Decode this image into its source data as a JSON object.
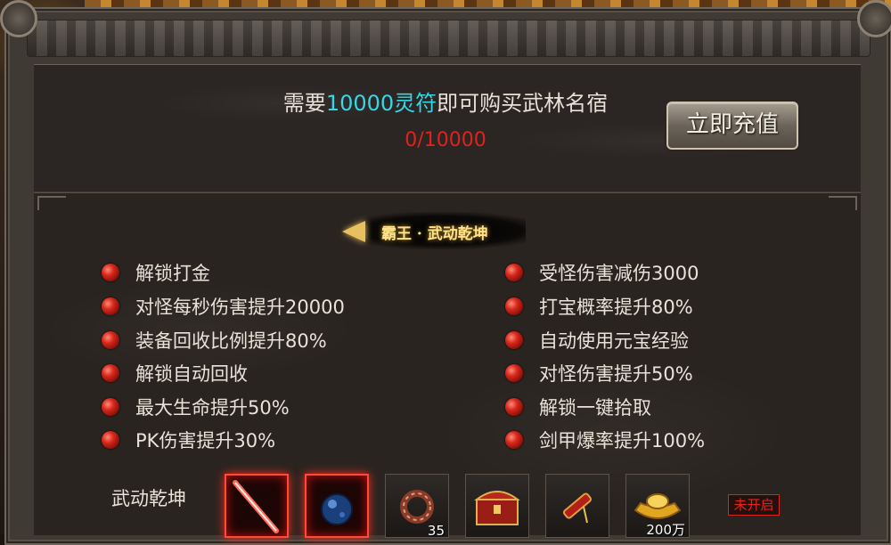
{
  "header": {
    "message_prefix": "需要",
    "message_highlight": "10000灵符",
    "message_suffix": "即可购买武林名宿",
    "progress": "0/10000",
    "recharge_button": "立即充值"
  },
  "tier": {
    "title": "霸王 · 武动乾坤"
  },
  "perks_left": [
    "解锁打金",
    "对怪每秒伤害提升20000",
    "装备回收比例提升80%",
    "解锁自动回收",
    "最大生命提升50%",
    "PK伤害提升30%"
  ],
  "perks_right": [
    "受怪伤害减伤3000",
    "打宝概率提升80%",
    "自动使用元宝经验",
    "对怪伤害提升50%",
    "解锁一键拾取",
    "剑甲爆率提升100%"
  ],
  "rewards": {
    "row_label": "武动乾坤",
    "items": [
      {
        "icon": "red-sword-icon",
        "count": ""
      },
      {
        "icon": "blue-orb-icon",
        "count": ""
      },
      {
        "icon": "bead-bracelet-icon",
        "count": "35"
      },
      {
        "icon": "treasure-chest-icon",
        "count": ""
      },
      {
        "icon": "red-scroll-icon",
        "count": ""
      },
      {
        "icon": "gold-ingot-icon",
        "count": "200万"
      }
    ],
    "status": "未开启"
  },
  "colors": {
    "highlight": "#35d6e6",
    "progress": "#e0221a",
    "title_gold": "#ffe28a"
  }
}
